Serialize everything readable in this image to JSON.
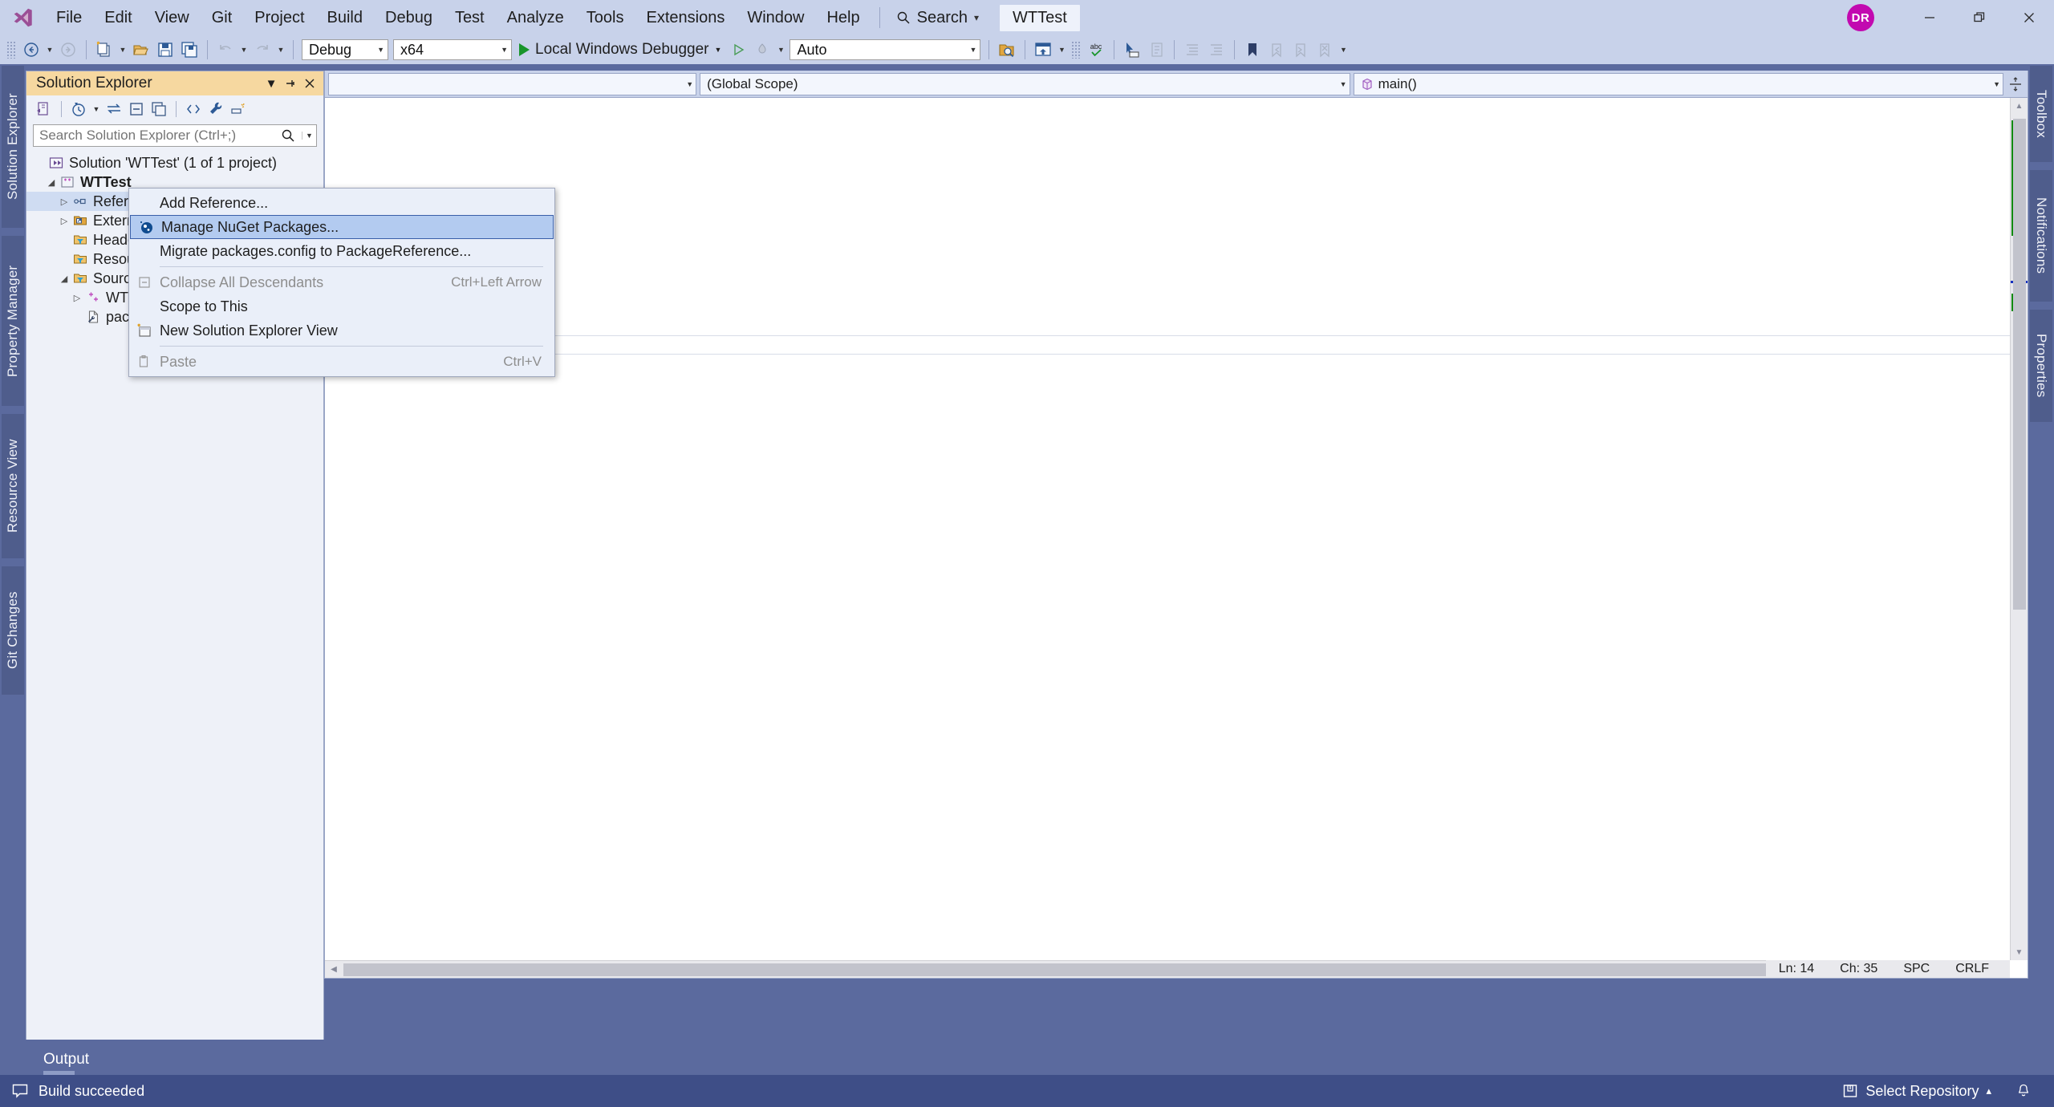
{
  "window": {
    "app_logo": "visual-studio-logo",
    "document_tab": "WTTest",
    "avatar_initials": "DR",
    "controls": {
      "minimize": "minimize-icon",
      "restore": "restore-icon",
      "close": "close-icon"
    }
  },
  "menubar": {
    "items": [
      {
        "label": "File"
      },
      {
        "label": "Edit"
      },
      {
        "label": "View"
      },
      {
        "label": "Git"
      },
      {
        "label": "Project"
      },
      {
        "label": "Build"
      },
      {
        "label": "Debug"
      },
      {
        "label": "Test"
      },
      {
        "label": "Analyze"
      },
      {
        "label": "Tools"
      },
      {
        "label": "Extensions"
      },
      {
        "label": "Window"
      },
      {
        "label": "Help"
      }
    ],
    "search": {
      "label": "Search",
      "icon": "search-icon",
      "caret": "▾"
    }
  },
  "toolbar": {
    "back_icon": "navigate-back-icon",
    "forward_icon": "navigate-forward-icon",
    "new_item_icon": "new-item-icon",
    "open_icon": "open-file-icon",
    "save_icon": "save-icon",
    "save_all_icon": "save-all-icon",
    "undo_icon": "undo-icon",
    "redo_icon": "redo-icon",
    "configuration": "Debug",
    "platform": "x64",
    "run_label": "Local Windows Debugger",
    "run_icon": "play-icon",
    "attach_icon": "play-outline-icon",
    "hotreload_icon": "hot-reload-icon",
    "auto_combo": "Auto",
    "find_in_files_icon": "find-in-files-icon",
    "solution_icon": "solution-icon",
    "spellcheck_icon": "spellcheck-abc-icon",
    "select_tool_icon": "pointer-select-icon",
    "comment_icon": "comment-selection-icon",
    "uncomment_icon": "uncomment-selection-icon",
    "indent_icon": "increase-indent-icon",
    "outdent_icon": "decrease-indent-icon",
    "bookmark_icon": "bookmark-icon",
    "prev_bookmark_icon": "previous-bookmark-icon",
    "next_bookmark_icon": "next-bookmark-icon",
    "clear_bookmarks_icon": "clear-bookmarks-icon",
    "overflow_icon": "toolbar-overflow-icon",
    "caret": "▾"
  },
  "left_dock": {
    "tabs": [
      {
        "label": "Solution Explorer"
      },
      {
        "label": "Property Manager"
      },
      {
        "label": "Resource View"
      },
      {
        "label": "Git Changes"
      }
    ]
  },
  "right_dock": {
    "tabs": [
      {
        "label": "Toolbox"
      },
      {
        "label": "Notifications"
      },
      {
        "label": "Properties"
      }
    ]
  },
  "solution_explorer": {
    "title": "Solution Explorer",
    "header_buttons": {
      "dropdown": "chevron-down-icon",
      "pin": "pin-icon",
      "close": "close-icon"
    },
    "toolbar_icons": [
      "home-solution-icon",
      "pending-changes-filter-icon",
      "sync-with-active-document-icon",
      "collapse-all-icon",
      "show-all-files-icon",
      "view-code-icon",
      "properties-wrench-icon",
      "preview-selected-items-icon"
    ],
    "search_placeholder": "Search Solution Explorer (Ctrl+;)",
    "search_value": "",
    "search_icon": "search-icon",
    "search_dropdown_icon": "chevron-down-icon",
    "tree": [
      {
        "indent": 0,
        "twisty": "",
        "icon": "solution-icon",
        "label": "Solution 'WTTest' (1 of 1 project)",
        "bold": false,
        "selected": false
      },
      {
        "indent": 1,
        "twisty": "expanded",
        "icon": "cpp-project-icon",
        "label": "WTTest",
        "bold": true,
        "selected": false
      },
      {
        "indent": 2,
        "twisty": "collapsed",
        "icon": "references-icon",
        "label": "References",
        "bold": false,
        "selected": true
      },
      {
        "indent": 2,
        "twisty": "collapsed",
        "icon": "external-dependencies-icon",
        "label": "External Dependencies",
        "bold": false,
        "selected": false
      },
      {
        "indent": 2,
        "twisty": "",
        "icon": "filter-folder-icon",
        "label": "Header Files",
        "bold": false,
        "selected": false
      },
      {
        "indent": 2,
        "twisty": "",
        "icon": "filter-folder-icon",
        "label": "Resource Files",
        "bold": false,
        "selected": false
      },
      {
        "indent": 2,
        "twisty": "expanded",
        "icon": "filter-folder-icon",
        "label": "Source Files",
        "bold": false,
        "selected": false
      },
      {
        "indent": 3,
        "twisty": "collapsed",
        "icon": "cpp-file-icon",
        "label": "WTTest.cpp",
        "bold": false,
        "selected": false
      },
      {
        "indent": 3,
        "twisty": "",
        "icon": "config-file-icon",
        "label": "packages.config",
        "bold": false,
        "selected": false
      }
    ]
  },
  "context_menu": {
    "items": [
      {
        "label": "Add Reference...",
        "shortcut": "",
        "icon": "",
        "state": "normal"
      },
      {
        "label": "Manage NuGet Packages...",
        "shortcut": "",
        "icon": "nuget-icon",
        "state": "highlight"
      },
      {
        "label": "Migrate packages.config to PackageReference...",
        "shortcut": "",
        "icon": "",
        "state": "normal"
      },
      {
        "separator": true
      },
      {
        "label": "Collapse All Descendants",
        "shortcut": "Ctrl+Left Arrow",
        "icon": "collapse-icon",
        "state": "disabled"
      },
      {
        "label": "Scope to This",
        "shortcut": "",
        "icon": "",
        "state": "normal"
      },
      {
        "label": "New Solution Explorer View",
        "shortcut": "",
        "icon": "new-solution-explorer-view-icon",
        "state": "normal"
      },
      {
        "separator": true
      },
      {
        "label": "Paste",
        "shortcut": "Ctrl+V",
        "icon": "paste-icon",
        "state": "disabled"
      }
    ]
  },
  "editor": {
    "navbar": {
      "project_combo": "",
      "scope_combo": "(Global Scope)",
      "member_combo": "main()",
      "member_icon": "method-icon",
      "scope_icon": "",
      "caret": "▾",
      "split_icon": "split-window-icon"
    },
    "status": {
      "line_label": "Ln: 14",
      "char_label": "Ch: 35",
      "spaces_label": "SPC",
      "eol_label": "CRLF"
    },
    "scroll": {
      "up_icon": "scroll-up-icon",
      "down_icon": "scroll-down-icon",
      "left_icon": "scroll-left-icon",
      "right_icon": "scroll-right-icon"
    }
  },
  "output_pane": {
    "tab_label": "Output"
  },
  "statusbar": {
    "build_status": "Build succeeded",
    "build_icon": "status-ready-icon",
    "repository_label": "Select Repository",
    "repository_icon": "repository-icon",
    "repository_caret": "▴",
    "notifications_icon": "bell-icon"
  },
  "colors": {
    "chrome": "#c8d2ea",
    "dock": "#5b6a9e",
    "statusbar": "#3e4e87",
    "accent_title": "#f6d8a0",
    "highlight": "#b3cbf0",
    "avatar": "#c209b0",
    "run_green": "#18952b",
    "change_marker": "#108a10"
  }
}
